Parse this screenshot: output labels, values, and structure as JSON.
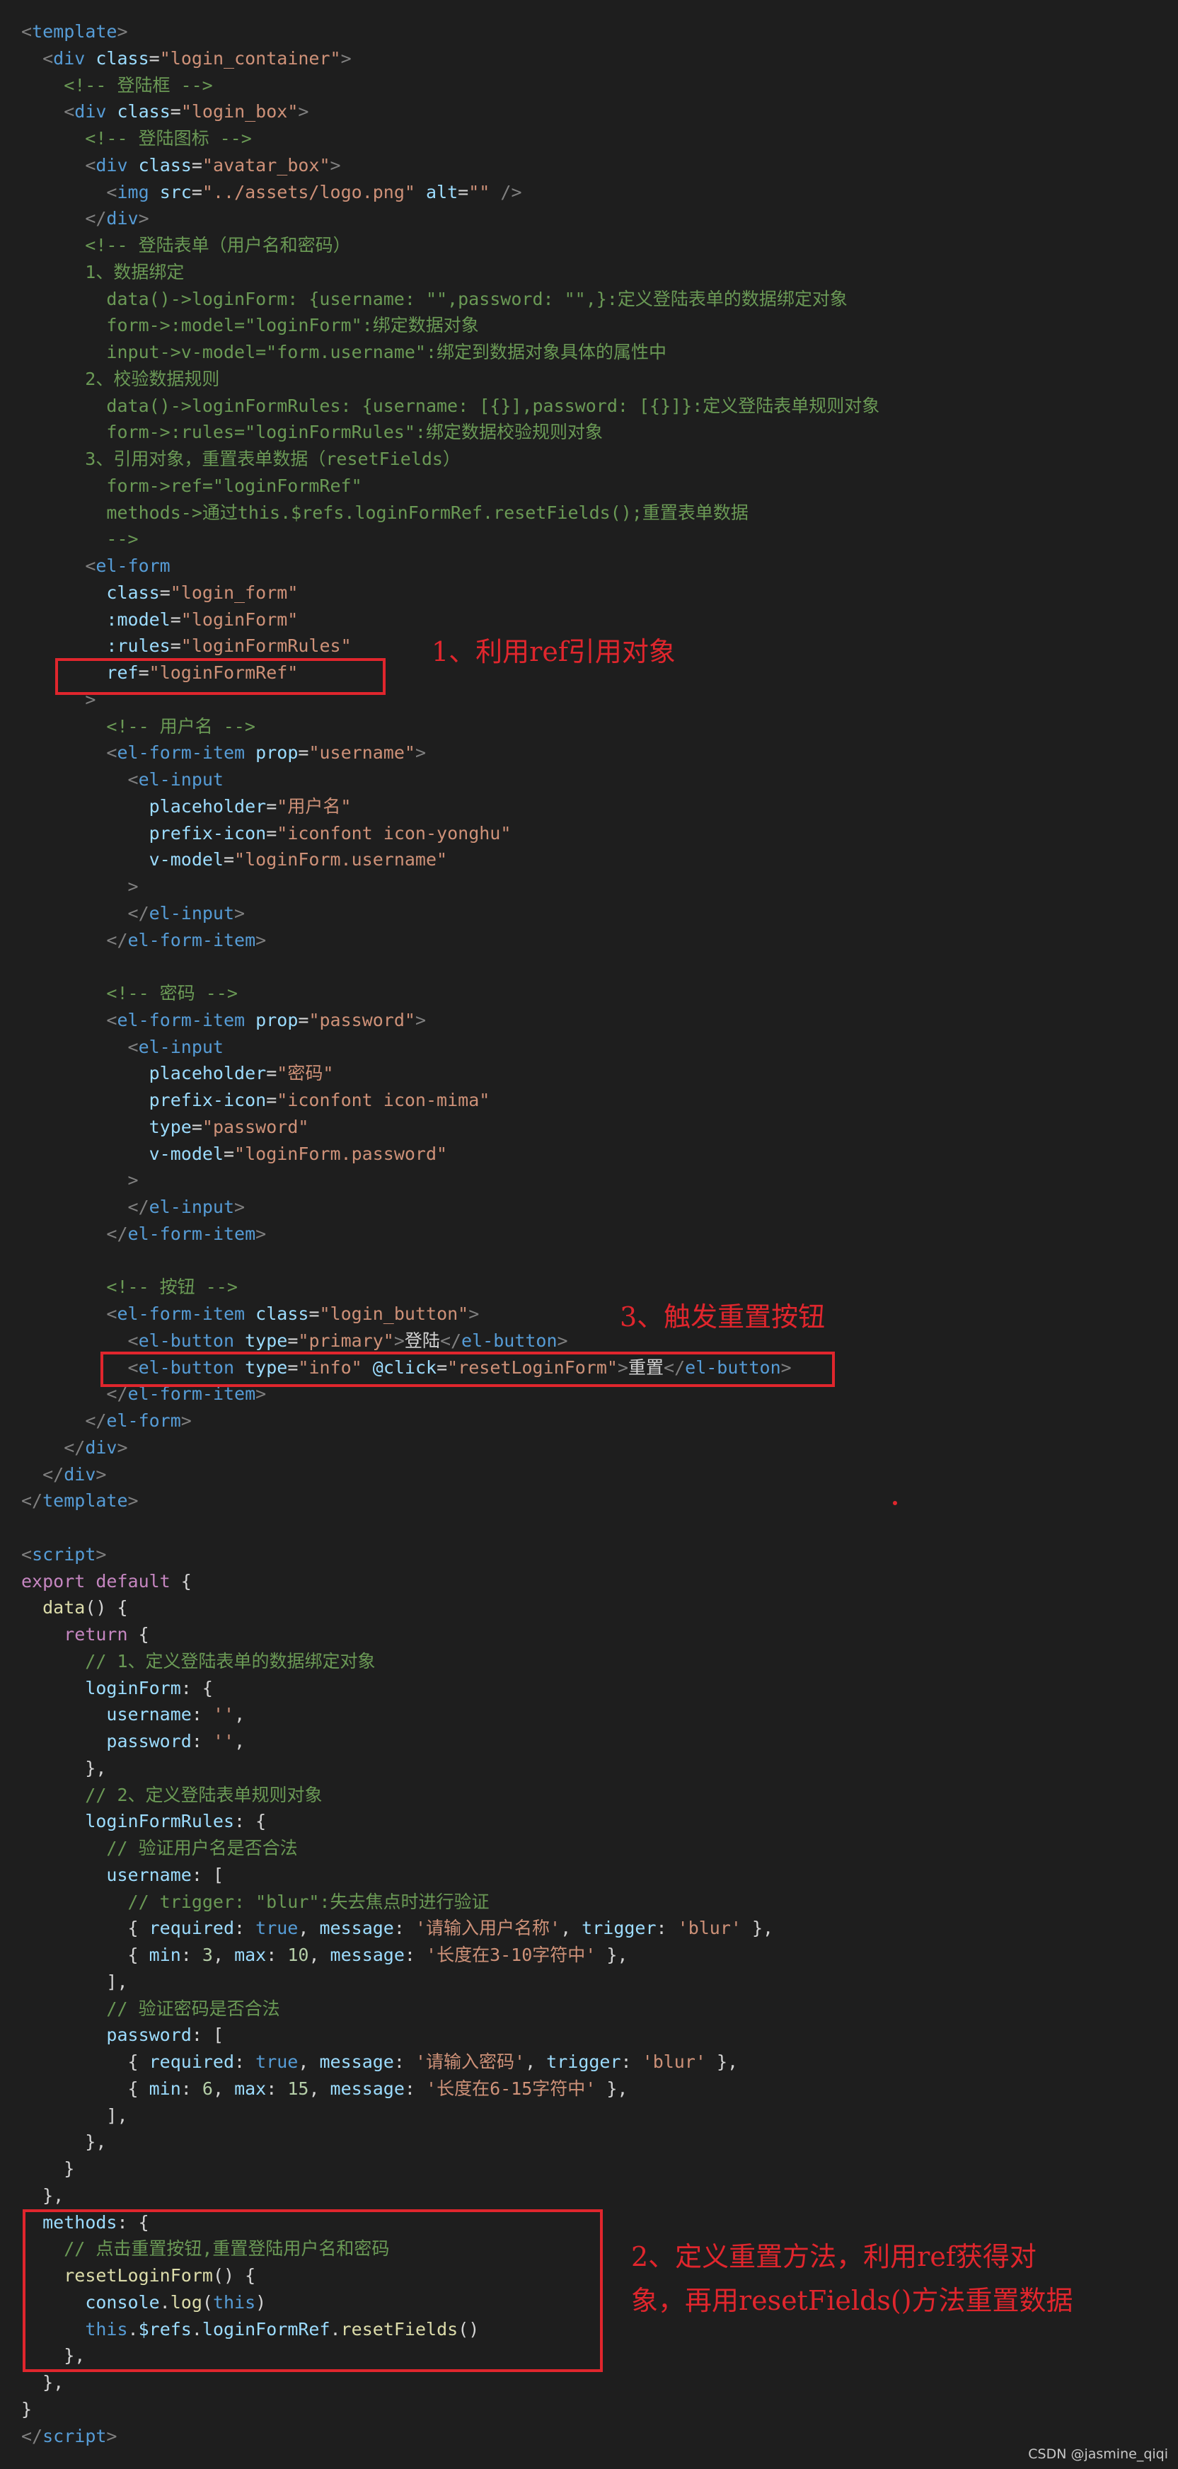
{
  "colors": {
    "background": "#1e1e1e",
    "tag_bracket": "#808080",
    "tag_name": "#569cd6",
    "attribute": "#9cdcfe",
    "string": "#ce9178",
    "comment": "#6a9955",
    "keyword": "#c586c0",
    "function": "#dcdcaa",
    "number": "#b5cea8",
    "plain": "#d4d4d4",
    "annotation": "#e0262d"
  },
  "code": [
    [
      [
        "b",
        "<"
      ],
      [
        "t",
        "template"
      ],
      [
        "b",
        ">"
      ]
    ],
    [
      [
        "p",
        "  "
      ],
      [
        "b",
        "<"
      ],
      [
        "t",
        "div"
      ],
      [
        "p",
        " "
      ],
      [
        "a",
        "class"
      ],
      [
        "p",
        "="
      ],
      [
        "s",
        "\"login_container\""
      ],
      [
        "b",
        ">"
      ]
    ],
    [
      [
        "c",
        "    <!-- 登陆框 -->"
      ]
    ],
    [
      [
        "p",
        "    "
      ],
      [
        "b",
        "<"
      ],
      [
        "t",
        "div"
      ],
      [
        "p",
        " "
      ],
      [
        "a",
        "class"
      ],
      [
        "p",
        "="
      ],
      [
        "s",
        "\"login_box\""
      ],
      [
        "b",
        ">"
      ]
    ],
    [
      [
        "c",
        "      <!-- 登陆图标 -->"
      ]
    ],
    [
      [
        "p",
        "      "
      ],
      [
        "b",
        "<"
      ],
      [
        "t",
        "div"
      ],
      [
        "p",
        " "
      ],
      [
        "a",
        "class"
      ],
      [
        "p",
        "="
      ],
      [
        "s",
        "\"avatar_box\""
      ],
      [
        "b",
        ">"
      ]
    ],
    [
      [
        "p",
        "        "
      ],
      [
        "b",
        "<"
      ],
      [
        "t",
        "img"
      ],
      [
        "p",
        " "
      ],
      [
        "a",
        "src"
      ],
      [
        "p",
        "="
      ],
      [
        "s",
        "\"../assets/logo.png\""
      ],
      [
        "p",
        " "
      ],
      [
        "a",
        "alt"
      ],
      [
        "p",
        "="
      ],
      [
        "s",
        "\"\""
      ],
      [
        "p",
        " "
      ],
      [
        "b",
        "/>"
      ]
    ],
    [
      [
        "p",
        "      "
      ],
      [
        "b",
        "</"
      ],
      [
        "t",
        "div"
      ],
      [
        "b",
        ">"
      ]
    ],
    [
      [
        "c",
        "      <!-- 登陆表单（用户名和密码）"
      ]
    ],
    [
      [
        "c",
        "      1、数据绑定"
      ]
    ],
    [
      [
        "c",
        "        data()->loginForm: {username: \"\",password: \"\",}:定义登陆表单的数据绑定对象"
      ]
    ],
    [
      [
        "c",
        "        form->:model=\"loginForm\":绑定数据对象"
      ]
    ],
    [
      [
        "c",
        "        input->v-model=\"form.username\":绑定到数据对象具体的属性中"
      ]
    ],
    [
      [
        "c",
        "      2、校验数据规则"
      ]
    ],
    [
      [
        "c",
        "        data()->loginFormRules: {username: [{}],password: [{}]}:定义登陆表单规则对象"
      ]
    ],
    [
      [
        "c",
        "        form->:rules=\"loginFormRules\":绑定数据校验规则对象"
      ]
    ],
    [
      [
        "c",
        "      3、引用对象，重置表单数据（resetFields）"
      ]
    ],
    [
      [
        "c",
        "        form->ref=\"loginFormRef\""
      ]
    ],
    [
      [
        "c",
        "        methods->通过this.$refs.loginFormRef.resetFields();重置表单数据"
      ]
    ],
    [
      [
        "c",
        "        -->"
      ]
    ],
    [
      [
        "p",
        "      "
      ],
      [
        "b",
        "<"
      ],
      [
        "t",
        "el-form"
      ]
    ],
    [
      [
        "p",
        "        "
      ],
      [
        "a",
        "class"
      ],
      [
        "p",
        "="
      ],
      [
        "s",
        "\"login_form\""
      ]
    ],
    [
      [
        "p",
        "        "
      ],
      [
        "a",
        ":model"
      ],
      [
        "p",
        "="
      ],
      [
        "s",
        "\"loginForm\""
      ]
    ],
    [
      [
        "p",
        "        "
      ],
      [
        "a",
        ":rules"
      ],
      [
        "p",
        "="
      ],
      [
        "s",
        "\"loginFormRules\""
      ]
    ],
    [
      [
        "p",
        "        "
      ],
      [
        "a",
        "ref"
      ],
      [
        "p",
        "="
      ],
      [
        "s",
        "\"loginFormRef\""
      ]
    ],
    [
      [
        "p",
        "      "
      ],
      [
        "b",
        ">"
      ]
    ],
    [
      [
        "c",
        "        <!-- 用户名 -->"
      ]
    ],
    [
      [
        "p",
        "        "
      ],
      [
        "b",
        "<"
      ],
      [
        "t",
        "el-form-item"
      ],
      [
        "p",
        " "
      ],
      [
        "a",
        "prop"
      ],
      [
        "p",
        "="
      ],
      [
        "s",
        "\"username\""
      ],
      [
        "b",
        ">"
      ]
    ],
    [
      [
        "p",
        "          "
      ],
      [
        "b",
        "<"
      ],
      [
        "t",
        "el-input"
      ]
    ],
    [
      [
        "p",
        "            "
      ],
      [
        "a",
        "placeholder"
      ],
      [
        "p",
        "="
      ],
      [
        "s",
        "\"用户名\""
      ]
    ],
    [
      [
        "p",
        "            "
      ],
      [
        "a",
        "prefix-icon"
      ],
      [
        "p",
        "="
      ],
      [
        "s",
        "\"iconfont icon-yonghu\""
      ]
    ],
    [
      [
        "p",
        "            "
      ],
      [
        "a",
        "v-model"
      ],
      [
        "p",
        "="
      ],
      [
        "s",
        "\"loginForm.username\""
      ]
    ],
    [
      [
        "p",
        "          "
      ],
      [
        "b",
        ">"
      ]
    ],
    [
      [
        "p",
        "          "
      ],
      [
        "b",
        "</"
      ],
      [
        "t",
        "el-input"
      ],
      [
        "b",
        ">"
      ]
    ],
    [
      [
        "p",
        "        "
      ],
      [
        "b",
        "</"
      ],
      [
        "t",
        "el-form-item"
      ],
      [
        "b",
        ">"
      ]
    ],
    [
      [
        "p",
        ""
      ]
    ],
    [
      [
        "c",
        "        <!-- 密码 -->"
      ]
    ],
    [
      [
        "p",
        "        "
      ],
      [
        "b",
        "<"
      ],
      [
        "t",
        "el-form-item"
      ],
      [
        "p",
        " "
      ],
      [
        "a",
        "prop"
      ],
      [
        "p",
        "="
      ],
      [
        "s",
        "\"password\""
      ],
      [
        "b",
        ">"
      ]
    ],
    [
      [
        "p",
        "          "
      ],
      [
        "b",
        "<"
      ],
      [
        "t",
        "el-input"
      ]
    ],
    [
      [
        "p",
        "            "
      ],
      [
        "a",
        "placeholder"
      ],
      [
        "p",
        "="
      ],
      [
        "s",
        "\"密码\""
      ]
    ],
    [
      [
        "p",
        "            "
      ],
      [
        "a",
        "prefix-icon"
      ],
      [
        "p",
        "="
      ],
      [
        "s",
        "\"iconfont icon-mima\""
      ]
    ],
    [
      [
        "p",
        "            "
      ],
      [
        "a",
        "type"
      ],
      [
        "p",
        "="
      ],
      [
        "s",
        "\"password\""
      ]
    ],
    [
      [
        "p",
        "            "
      ],
      [
        "a",
        "v-model"
      ],
      [
        "p",
        "="
      ],
      [
        "s",
        "\"loginForm.password\""
      ]
    ],
    [
      [
        "p",
        "          "
      ],
      [
        "b",
        ">"
      ]
    ],
    [
      [
        "p",
        "          "
      ],
      [
        "b",
        "</"
      ],
      [
        "t",
        "el-input"
      ],
      [
        "b",
        ">"
      ]
    ],
    [
      [
        "p",
        "        "
      ],
      [
        "b",
        "</"
      ],
      [
        "t",
        "el-form-item"
      ],
      [
        "b",
        ">"
      ]
    ],
    [
      [
        "p",
        ""
      ]
    ],
    [
      [
        "c",
        "        <!-- 按钮 -->"
      ]
    ],
    [
      [
        "p",
        "        "
      ],
      [
        "b",
        "<"
      ],
      [
        "t",
        "el-form-item"
      ],
      [
        "p",
        " "
      ],
      [
        "a",
        "class"
      ],
      [
        "p",
        "="
      ],
      [
        "s",
        "\"login_button\""
      ],
      [
        "b",
        ">"
      ]
    ],
    [
      [
        "p",
        "          "
      ],
      [
        "b",
        "<"
      ],
      [
        "t",
        "el-button"
      ],
      [
        "p",
        " "
      ],
      [
        "a",
        "type"
      ],
      [
        "p",
        "="
      ],
      [
        "s",
        "\"primary\""
      ],
      [
        "b",
        ">"
      ],
      [
        "p",
        "登陆"
      ],
      [
        "b",
        "</"
      ],
      [
        "t",
        "el-button"
      ],
      [
        "b",
        ">"
      ]
    ],
    [
      [
        "p",
        "          "
      ],
      [
        "b",
        "<"
      ],
      [
        "t",
        "el-button"
      ],
      [
        "p",
        " "
      ],
      [
        "a",
        "type"
      ],
      [
        "p",
        "="
      ],
      [
        "s",
        "\"info\""
      ],
      [
        "p",
        " "
      ],
      [
        "a",
        "@click"
      ],
      [
        "p",
        "="
      ],
      [
        "s",
        "\"resetLoginForm\""
      ],
      [
        "b",
        ">"
      ],
      [
        "p",
        "重置"
      ],
      [
        "b",
        "</"
      ],
      [
        "t",
        "el-button"
      ],
      [
        "b",
        ">"
      ]
    ],
    [
      [
        "p",
        "        "
      ],
      [
        "b",
        "</"
      ],
      [
        "t",
        "el-form-item"
      ],
      [
        "b",
        ">"
      ]
    ],
    [
      [
        "p",
        "      "
      ],
      [
        "b",
        "</"
      ],
      [
        "t",
        "el-form"
      ],
      [
        "b",
        ">"
      ]
    ],
    [
      [
        "p",
        "    "
      ],
      [
        "b",
        "</"
      ],
      [
        "t",
        "div"
      ],
      [
        "b",
        ">"
      ]
    ],
    [
      [
        "p",
        "  "
      ],
      [
        "b",
        "</"
      ],
      [
        "t",
        "div"
      ],
      [
        "b",
        ">"
      ]
    ],
    [
      [
        "b",
        "</"
      ],
      [
        "t",
        "template"
      ],
      [
        "b",
        ">"
      ]
    ],
    [
      [
        "p",
        ""
      ]
    ],
    [
      [
        "b",
        "<"
      ],
      [
        "t",
        "script"
      ],
      [
        "b",
        ">"
      ]
    ],
    [
      [
        "k",
        "export"
      ],
      [
        "p",
        " "
      ],
      [
        "k",
        "default"
      ],
      [
        "p",
        " {"
      ]
    ],
    [
      [
        "p",
        "  "
      ],
      [
        "f",
        "data"
      ],
      [
        "p",
        "() {"
      ]
    ],
    [
      [
        "p",
        "    "
      ],
      [
        "k",
        "return"
      ],
      [
        "p",
        " {"
      ]
    ],
    [
      [
        "c",
        "      // 1、定义登陆表单的数据绑定对象"
      ]
    ],
    [
      [
        "p",
        "      "
      ],
      [
        "a",
        "loginForm"
      ],
      [
        "p",
        ": {"
      ]
    ],
    [
      [
        "p",
        "        "
      ],
      [
        "a",
        "username"
      ],
      [
        "p",
        ": "
      ],
      [
        "s",
        "''"
      ],
      [
        "p",
        ","
      ]
    ],
    [
      [
        "p",
        "        "
      ],
      [
        "a",
        "password"
      ],
      [
        "p",
        ": "
      ],
      [
        "s",
        "''"
      ],
      [
        "p",
        ","
      ]
    ],
    [
      [
        "p",
        "      },"
      ]
    ],
    [
      [
        "c",
        "      // 2、定义登陆表单规则对象"
      ]
    ],
    [
      [
        "p",
        "      "
      ],
      [
        "a",
        "loginFormRules"
      ],
      [
        "p",
        ": {"
      ]
    ],
    [
      [
        "c",
        "        // 验证用户名是否合法"
      ]
    ],
    [
      [
        "p",
        "        "
      ],
      [
        "a",
        "username"
      ],
      [
        "p",
        ": ["
      ]
    ],
    [
      [
        "c",
        "          // trigger: \"blur\":失去焦点时进行验证"
      ]
    ],
    [
      [
        "p",
        "          { "
      ],
      [
        "a",
        "required"
      ],
      [
        "p",
        ": "
      ],
      [
        "t",
        "true"
      ],
      [
        "p",
        ", "
      ],
      [
        "a",
        "message"
      ],
      [
        "p",
        ": "
      ],
      [
        "s",
        "'请输入用户名称'"
      ],
      [
        "p",
        ", "
      ],
      [
        "a",
        "trigger"
      ],
      [
        "p",
        ": "
      ],
      [
        "s",
        "'blur'"
      ],
      [
        "p",
        " },"
      ]
    ],
    [
      [
        "p",
        "          { "
      ],
      [
        "a",
        "min"
      ],
      [
        "p",
        ": "
      ],
      [
        "n",
        "3"
      ],
      [
        "p",
        ", "
      ],
      [
        "a",
        "max"
      ],
      [
        "p",
        ": "
      ],
      [
        "n",
        "10"
      ],
      [
        "p",
        ", "
      ],
      [
        "a",
        "message"
      ],
      [
        "p",
        ": "
      ],
      [
        "s",
        "'长度在3-10字符中'"
      ],
      [
        "p",
        " },"
      ]
    ],
    [
      [
        "p",
        "        ],"
      ]
    ],
    [
      [
        "c",
        "        // 验证密码是否合法"
      ]
    ],
    [
      [
        "p",
        "        "
      ],
      [
        "a",
        "password"
      ],
      [
        "p",
        ": ["
      ]
    ],
    [
      [
        "p",
        "          { "
      ],
      [
        "a",
        "required"
      ],
      [
        "p",
        ": "
      ],
      [
        "t",
        "true"
      ],
      [
        "p",
        ", "
      ],
      [
        "a",
        "message"
      ],
      [
        "p",
        ": "
      ],
      [
        "s",
        "'请输入密码'"
      ],
      [
        "p",
        ", "
      ],
      [
        "a",
        "trigger"
      ],
      [
        "p",
        ": "
      ],
      [
        "s",
        "'blur'"
      ],
      [
        "p",
        " },"
      ]
    ],
    [
      [
        "p",
        "          { "
      ],
      [
        "a",
        "min"
      ],
      [
        "p",
        ": "
      ],
      [
        "n",
        "6"
      ],
      [
        "p",
        ", "
      ],
      [
        "a",
        "max"
      ],
      [
        "p",
        ": "
      ],
      [
        "n",
        "15"
      ],
      [
        "p",
        ", "
      ],
      [
        "a",
        "message"
      ],
      [
        "p",
        ": "
      ],
      [
        "s",
        "'长度在6-15字符中'"
      ],
      [
        "p",
        " },"
      ]
    ],
    [
      [
        "p",
        "        ],"
      ]
    ],
    [
      [
        "p",
        "      },"
      ]
    ],
    [
      [
        "p",
        "    }"
      ]
    ],
    [
      [
        "p",
        "  },"
      ]
    ],
    [
      [
        "p",
        "  "
      ],
      [
        "a",
        "methods"
      ],
      [
        "p",
        ": {"
      ]
    ],
    [
      [
        "c",
        "    // 点击重置按钮,重置登陆用户名和密码"
      ]
    ],
    [
      [
        "p",
        "    "
      ],
      [
        "f",
        "resetLoginForm"
      ],
      [
        "p",
        "() {"
      ]
    ],
    [
      [
        "p",
        "      "
      ],
      [
        "a",
        "console"
      ],
      [
        "p",
        "."
      ],
      [
        "f",
        "log"
      ],
      [
        "p",
        "("
      ],
      [
        "t",
        "this"
      ],
      [
        "p",
        ")"
      ]
    ],
    [
      [
        "p",
        "      "
      ],
      [
        "t",
        "this"
      ],
      [
        "p",
        "."
      ],
      [
        "a",
        "$refs"
      ],
      [
        "p",
        "."
      ],
      [
        "a",
        "loginFormRef"
      ],
      [
        "p",
        "."
      ],
      [
        "f",
        "resetFields"
      ],
      [
        "p",
        "()"
      ]
    ],
    [
      [
        "p",
        "    },"
      ]
    ],
    [
      [
        "p",
        "  },"
      ]
    ],
    [
      [
        "p",
        "}"
      ]
    ],
    [
      [
        "b",
        "</"
      ],
      [
        "t",
        "script"
      ],
      [
        "b",
        ">"
      ]
    ]
  ],
  "annotations": [
    {
      "id": "anno-1",
      "text": "1、利用ref引用对象"
    },
    {
      "id": "anno-2",
      "text": "2、定义重置方法，利用ref获得对象，再用resetFields()方法重置数据"
    },
    {
      "id": "anno-3",
      "text": "3、触发重置按钮"
    }
  ],
  "watermark": "CSDN @jasmine_qiqi"
}
